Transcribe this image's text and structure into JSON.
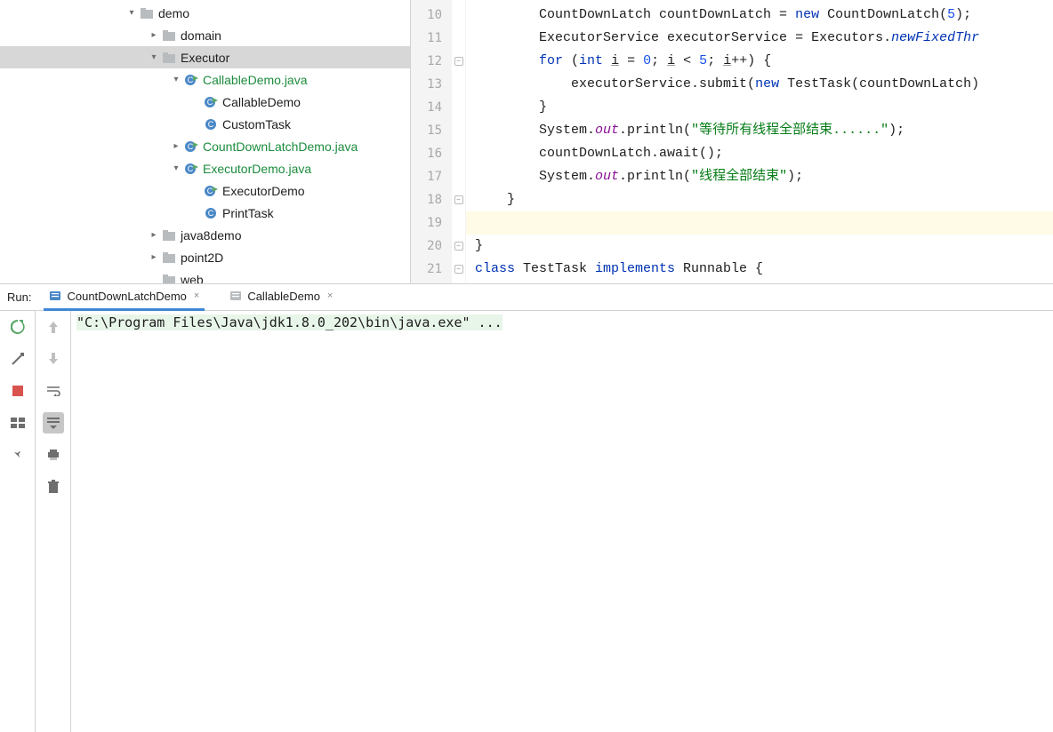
{
  "tree": {
    "demo": "demo",
    "domain": "domain",
    "executor": "Executor",
    "callableDemoJava": "CallableDemo.java",
    "callableDemo": "CallableDemo",
    "customTask": "CustomTask",
    "countDownLatchDemoJava": "CountDownLatchDemo.java",
    "executorDemoJava": "ExecutorDemo.java",
    "executorDemo": "ExecutorDemo",
    "printTask": "PrintTask",
    "java8demo": "java8demo",
    "point2D": "point2D",
    "web": "web"
  },
  "gutter": [
    "10",
    "11",
    "12",
    "13",
    "14",
    "15",
    "16",
    "17",
    "18",
    "19",
    "20",
    "21"
  ],
  "code": {
    "l10_a": "CountDownLatch countDownLatch = ",
    "l10_new": "new",
    "l10_b": " CountDownLatch(",
    "l10_num": "5",
    "l10_c": ");",
    "l11_a": "ExecutorService executorService = Executors.",
    "l11_m": "newFixedThr",
    "l12_for": "for",
    "l12_a": " (",
    "l12_int": "int",
    "l12_b": " ",
    "l12_i1": "i",
    "l12_c": " = ",
    "l12_z": "0",
    "l12_d": "; ",
    "l12_i2": "i",
    "l12_e": " < ",
    "l12_five": "5",
    "l12_f": "; ",
    "l12_i3": "i",
    "l12_g": "++) {",
    "l13_a": "    executorService.submit(",
    "l13_new": "new",
    "l13_b": " TestTask(countDownLatch)",
    "l14": "}",
    "l15_a": "System.",
    "l15_out": "out",
    "l15_b": ".println(",
    "l15_s": "\"等待所有线程全部结束......\"",
    "l15_c": ");",
    "l16": "countDownLatch.await();",
    "l17_a": "System.",
    "l17_out": "out",
    "l17_b": ".println(",
    "l17_s": "\"线程全部结束\"",
    "l17_c": ");",
    "l18": "    }",
    "l20": "}",
    "l21_class": "class",
    "l21_a": " TestTask ",
    "l21_impl": "implements",
    "l21_b": " Runnable {"
  },
  "run": {
    "label": "Run:",
    "tab1": "CountDownLatchDemo",
    "tab2": "CallableDemo",
    "close": "×",
    "console": "\"C:\\Program Files\\Java\\jdk1.8.0_202\\bin\\java.exe\" ..."
  }
}
